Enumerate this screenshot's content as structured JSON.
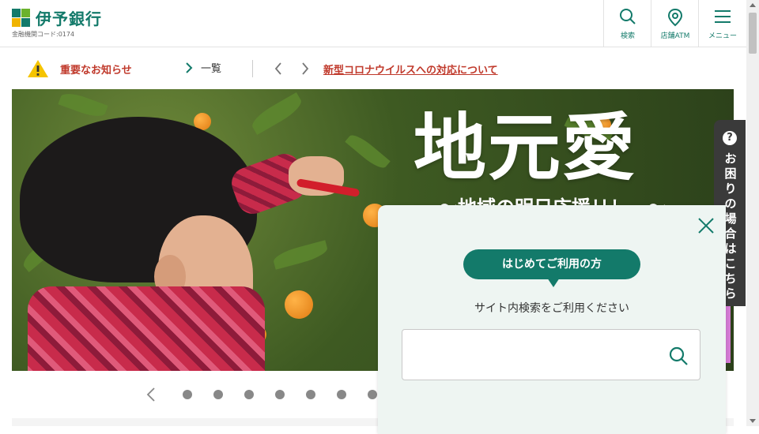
{
  "header": {
    "logo_name": "伊予銀行",
    "bank_code": "金融機関コード:0174",
    "buttons": [
      {
        "label": "検索",
        "icon": "search-icon"
      },
      {
        "label": "店舗ATM",
        "icon": "map-pin-icon"
      },
      {
        "label": "メニュー",
        "icon": "hamburger-icon"
      }
    ]
  },
  "notice": {
    "title": "重要なお知らせ",
    "list_label": "一覧",
    "link_text": "新型コロナウイルスへの対応について"
  },
  "hero": {
    "headline": "地元愛",
    "subline": "〜地域の明日応援リレー〜"
  },
  "carousel": {
    "dot_count": 7
  },
  "help_tab": {
    "q_mark": "?",
    "text": "お困りの場合はこちら"
  },
  "popup": {
    "bubble": "はじめてご利用の方",
    "text": "サイト内検索をご利用ください",
    "search_placeholder": ""
  },
  "colors": {
    "brand": "#137a6a",
    "alert": "#c0392b",
    "help_tab": "#3a3a3a"
  }
}
